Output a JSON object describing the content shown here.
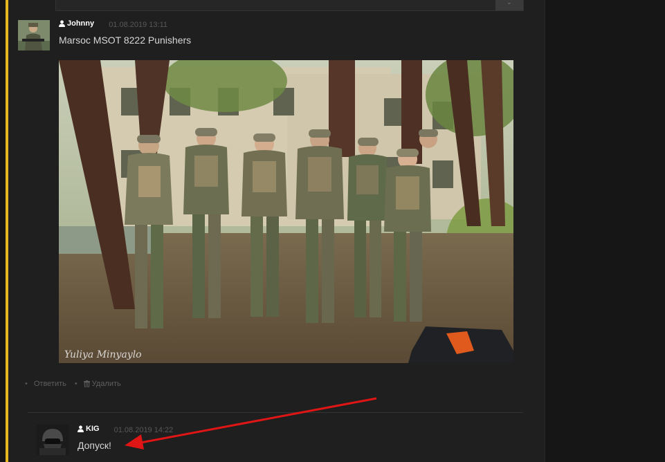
{
  "comments": [
    {
      "author": "Johnny",
      "date": "01.08.2019 13:11",
      "text": "Marsoc MSOT 8222 Punishers",
      "photo_watermark": "Yuliya Minyaylo"
    },
    {
      "author": "KIG",
      "date": "01.08.2019 14:22",
      "text": "Допуск!"
    }
  ],
  "actions": {
    "reply_label": "Ответить",
    "delete_label": "Удалить"
  },
  "icons": {
    "author": "user-icon",
    "delete": "trash-icon",
    "search": "chevron-icon"
  },
  "colors": {
    "accent_line": "#e6b71e",
    "annotation_arrow": "#e01515",
    "background": "#1f1f1f"
  }
}
